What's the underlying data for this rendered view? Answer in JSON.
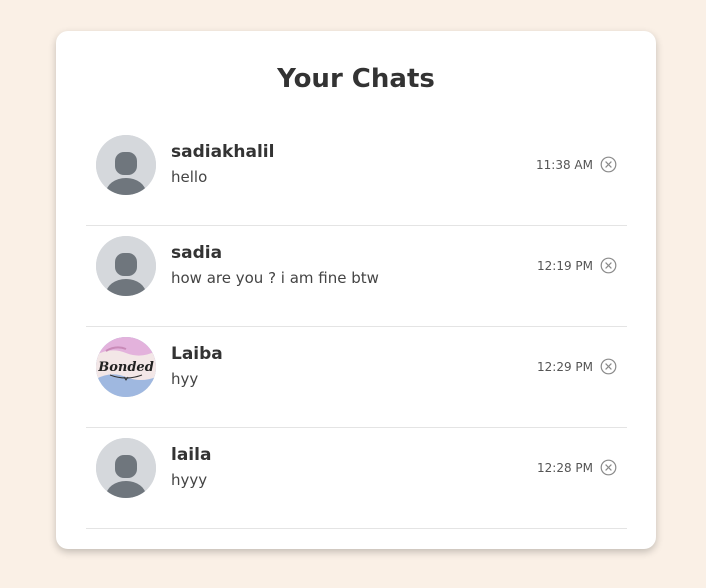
{
  "page": {
    "title": "Your Chats"
  },
  "colors": {
    "background": "#faf0e6",
    "card": "#ffffff",
    "divider": "#e4e4e4",
    "avatar_placeholder": "#d5d8dc",
    "avatar_figure": "#6f767d"
  },
  "chats": [
    {
      "name": "sadiakhalil",
      "message": "hello",
      "time": "11:38 AM",
      "avatar": "default-avatar-icon"
    },
    {
      "name": "sadia",
      "message": "how are you ? i am fine btw",
      "time": "12:19 PM",
      "avatar": "default-avatar-icon"
    },
    {
      "name": "Laiba",
      "message": "hyy",
      "time": "12:29 PM",
      "avatar": "profile-photo",
      "avatar_text": "Bonded"
    },
    {
      "name": "laila",
      "message": "hyyy",
      "time": "12:28 PM",
      "avatar": "default-avatar-icon"
    }
  ]
}
